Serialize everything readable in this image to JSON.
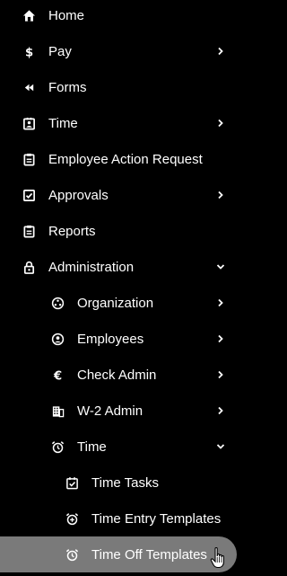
{
  "accent_active_bg": "#7a7a7a",
  "menu": [
    {
      "id": "home",
      "label": "Home",
      "icon": "home-icon",
      "chevron": ""
    },
    {
      "id": "pay",
      "label": "Pay",
      "icon": "dollar-icon",
      "chevron": "right"
    },
    {
      "id": "forms",
      "label": "Forms",
      "icon": "rewind-icon",
      "chevron": ""
    },
    {
      "id": "time",
      "label": "Time",
      "icon": "timeclock-icon",
      "chevron": "right"
    },
    {
      "id": "employee-action-request",
      "label": "Employee Action Request",
      "icon": "clipboard-icon",
      "chevron": ""
    },
    {
      "id": "approvals",
      "label": "Approvals",
      "icon": "checkbox-icon",
      "chevron": "right"
    },
    {
      "id": "reports",
      "label": "Reports",
      "icon": "clipboard-icon",
      "chevron": ""
    },
    {
      "id": "administration",
      "label": "Administration",
      "icon": "lock-icon",
      "chevron": "down"
    },
    {
      "id": "organization",
      "label": "Organization",
      "icon": "org-icon",
      "chevron": "right"
    },
    {
      "id": "employees",
      "label": "Employees",
      "icon": "user-circle-icon",
      "chevron": "right"
    },
    {
      "id": "check-admin",
      "label": "Check Admin",
      "icon": "euro-icon",
      "chevron": "right"
    },
    {
      "id": "w2-admin",
      "label": "W-2 Admin",
      "icon": "building-icon",
      "chevron": "right"
    },
    {
      "id": "admin-time",
      "label": "Time",
      "icon": "alarm-clock-icon",
      "chevron": "down"
    },
    {
      "id": "time-tasks",
      "label": "Time Tasks",
      "icon": "calendar-check-icon",
      "chevron": ""
    },
    {
      "id": "time-entry-templates",
      "label": "Time Entry Templates",
      "icon": "alarm-add-icon",
      "chevron": ""
    },
    {
      "id": "time-off-templates",
      "label": "Time Off Templates",
      "icon": "alarm-clock-icon",
      "chevron": "",
      "active": true
    }
  ]
}
